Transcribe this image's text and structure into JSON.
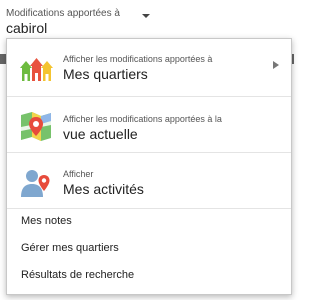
{
  "trigger": {
    "caption": "Modifications apportées à",
    "value": "cabirol",
    "caret_icon": "chevron-down-icon"
  },
  "menu": {
    "items": [
      {
        "icon": "neighborhood-houses-icon",
        "caption": "Afficher les modifications apportées à",
        "label": "Mes quartiers",
        "has_submenu": true
      },
      {
        "icon": "map-pin-icon",
        "caption": "Afficher les modifications apportées à la",
        "label": "vue actuelle",
        "has_submenu": false
      },
      {
        "icon": "user-pin-icon",
        "caption": "Afficher",
        "label": "Mes activités",
        "has_submenu": false
      }
    ],
    "links": [
      {
        "label": "Mes notes"
      },
      {
        "label": "Gérer mes quartiers"
      },
      {
        "label": "Résultats de recherche"
      }
    ]
  },
  "colors": {
    "house_green": "#6dbb3f",
    "house_red": "#e8533f",
    "house_yellow": "#f4c430",
    "pin_red": "#e74b3c",
    "map_green": "#77c26b",
    "map_yellow": "#f2d44a",
    "user_blue": "#7fa7cf"
  }
}
